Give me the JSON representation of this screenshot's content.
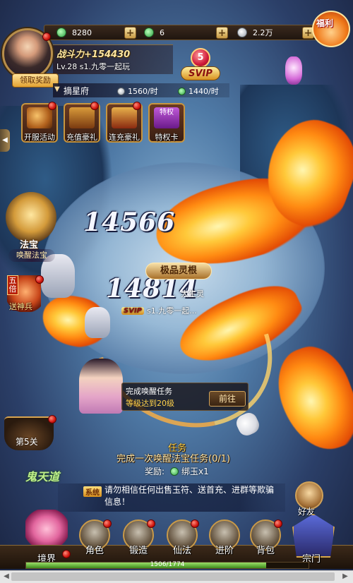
{
  "resources": {
    "jade": "8280",
    "bound_jade": "6",
    "silver": "2.2万"
  },
  "player": {
    "power": "战斗力+154430",
    "level_line": "Lv.28 s1.九零一起玩",
    "claim_reward": "领取奖励",
    "vip_level": "5",
    "vip_label": "SVIP"
  },
  "location": {
    "name": "摘星府",
    "silver_rate": "1560/时",
    "jade_rate": "1440/时"
  },
  "features": [
    {
      "label": "开服活动",
      "icon": "horn-icon"
    },
    {
      "label": "充值豪礼",
      "icon": "treasure-chest-icon"
    },
    {
      "label": "连充豪礼",
      "icon": "treasure-chest-icon"
    },
    {
      "label": "特权卡",
      "icon": "privilege-card-icon",
      "art_text": "特权"
    }
  ],
  "welfare": "福利",
  "battle": {
    "damage_1": "14566",
    "damage_2": "14814",
    "fabao_title": "法宝",
    "fabao_sub": "唤醒法宝",
    "shenbing_badge": "五倍",
    "shenbing_label": "送神兵",
    "spirit_root": "极品灵根",
    "player_title": "大生灵",
    "player_vip": "SVIP",
    "player_name": "s1.九零一起..."
  },
  "task_bubble": {
    "title": "完成唤醒任务",
    "subtitle": "等级达到20级",
    "go": "前往"
  },
  "stage": "第5关",
  "quest": {
    "title": "任务",
    "line": "完成一次唤醒法宝任务",
    "progress": "(0/1)",
    "reward_label": "奖励:",
    "reward_item": "绑玉x1"
  },
  "chat": {
    "tag": "系统",
    "text": "请勿相信任何出售玉符、送首充、进群等欺骗信息！",
    "left_deco": "鬼天道"
  },
  "friends": "好友",
  "nav": [
    {
      "label": "境界",
      "icon": "lotus-icon"
    },
    {
      "label": "角色",
      "icon": "character-icon"
    },
    {
      "label": "锻造",
      "icon": "anvil-icon"
    },
    {
      "label": "仙法",
      "icon": "lotus-magic-icon"
    },
    {
      "label": "进阶",
      "icon": "yin-yang-icon"
    },
    {
      "label": "背包",
      "icon": "chest-icon"
    },
    {
      "label": "宗门",
      "icon": "sect-gate-icon"
    }
  ],
  "exp": {
    "text": "1506/1774",
    "fraction": 0.849
  }
}
